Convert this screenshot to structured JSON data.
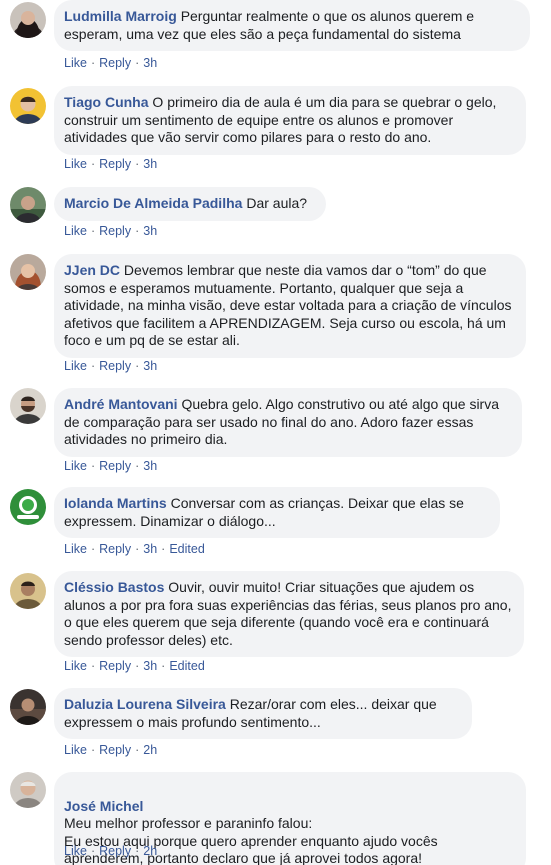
{
  "actions": {
    "like": "Like",
    "reply": "Reply",
    "separator": "·",
    "edited": "Edited"
  },
  "comments": [
    {
      "author": "Ludmilla Marroig",
      "text": "Perguntar realmente o que os alunos querem e esperam, uma vez que eles são a peça fundamental do sistema",
      "time": "3h",
      "edited": false,
      "avatar_icon": "woman-dark-hair-avatar"
    },
    {
      "author": "Tiago Cunha",
      "text": "O primeiro dia de aula é um dia para se quebrar o gelo, construir um sentimento de equipe entre os alunos e promover atividades que vão servir como pilares para o resto do ano.",
      "time": "3h",
      "edited": false,
      "avatar_icon": "man-yellow-background-avatar"
    },
    {
      "author": "Marcio De Almeida Padilha",
      "text": "Dar aula?",
      "time": "3h",
      "edited": false,
      "avatar_icon": "man-outdoor-avatar"
    },
    {
      "author": "JJen DC",
      "text": "Devemos lembrar que neste dia vamos dar o “tom” do que somos e esperamos mutuamente. Portanto, qualquer que seja a atividade, na minha visão, deve estar voltada para a criação de vínculos afetivos que facilitem a APRENDIZAGEM. Seja curso ou escola, há um foco e um pq de se estar ali.",
      "time": "3h",
      "edited": false,
      "avatar_icon": "woman-red-hair-avatar"
    },
    {
      "author": "André Mantovani",
      "text": "Quebra gelo. Algo construtivo ou até algo que sirva de comparação para ser usado no final do ano. Adoro fazer essas atividades no primeiro dia.",
      "time": "3h",
      "edited": false,
      "avatar_icon": "man-bearded-avatar"
    },
    {
      "author": "Iolanda Martins",
      "text": "Conversar com as crianças. Deixar que elas se expressem. Dinamizar o diálogo...",
      "time": "3h",
      "edited": true,
      "avatar_icon": "green-logo-avatar"
    },
    {
      "author": "Cléssio Bastos",
      "text": "Ouvir, ouvir muito! Criar situações que ajudem os alunos a por pra fora suas experiências das férias, seus planos pro ano, o que eles querem que seja diferente (quando você era e continuará sendo professor deles) etc.",
      "time": "3h",
      "edited": true,
      "avatar_icon": "man-beige-background-avatar"
    },
    {
      "author": "Daluzia Lourena Silveira",
      "text": "Rezar/orar com eles... deixar que expressem o mais profundo sentimento...",
      "time": "2h",
      "edited": false,
      "avatar_icon": "woman-dark-photo-avatar"
    },
    {
      "author": "José Michel",
      "text": "Meu melhor professor e paraninfo falou:\nEu estou aqui porque quero aprender enquanto ajudo vocês aprenderem, portanto declaro que já aprovei todos agora!",
      "time": "2h",
      "edited": false,
      "avatar_icon": "older-man-avatar"
    }
  ]
}
